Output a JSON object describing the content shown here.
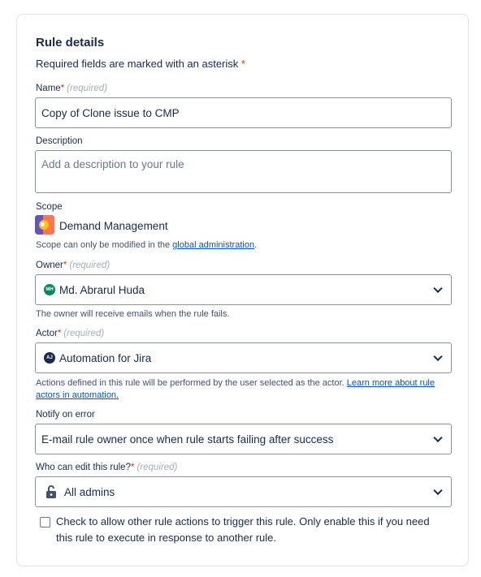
{
  "header": {
    "title": "Rule details",
    "subtitle": "Required fields are marked with an asterisk",
    "asterisk": "*"
  },
  "name_field": {
    "label": "Name",
    "asterisk": "*",
    "required": "(required)",
    "value": "Copy of Clone issue to CMP"
  },
  "description_field": {
    "label": "Description",
    "placeholder": "Add a description to your rule"
  },
  "scope": {
    "label": "Scope",
    "project_name": "Demand Management",
    "project_icon": "demand-management-project-icon",
    "helper_prefix": "Scope can only be modified in the ",
    "helper_link": "global administration",
    "helper_suffix": "."
  },
  "owner": {
    "label": "Owner",
    "asterisk": "*",
    "required": "(required)",
    "avatar_initials": "MH",
    "avatar_color": "#00875a",
    "value": "Md. Abrarul Huda",
    "helper": "The owner will receive emails when the rule fails."
  },
  "actor": {
    "label": "Actor",
    "asterisk": "*",
    "required": "(required)",
    "avatar_initials": "AJ",
    "avatar_color": "#172b4d",
    "value": "Automation for Jira",
    "helper_prefix": "Actions defined in this rule will be performed by the user selected as the actor. ",
    "helper_link_line1": "Learn more about rule",
    "helper_link_line2": "actors in automation."
  },
  "notify": {
    "label": "Notify on error",
    "value": "E-mail rule owner once when rule starts failing after success"
  },
  "who_can_edit": {
    "label": "Who can edit this rule?",
    "asterisk": "*",
    "required": "(required)",
    "icon": "unlock-icon",
    "value": "All admins"
  },
  "allow_trigger": {
    "checked": false,
    "label_line1": "Check to allow other rule actions to trigger this rule. Only enable this if you need",
    "label_line2": "this rule to execute in response to another rule."
  },
  "colors": {
    "primary_text": "#172b4d",
    "secondary_text": "#42526e",
    "required_asterisk": "#de350b",
    "link": "#0052cc",
    "border": "#8993a4"
  }
}
